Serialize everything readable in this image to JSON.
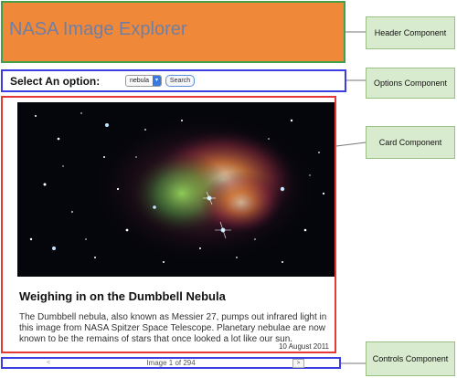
{
  "header": {
    "title": "NASA Image Explorer"
  },
  "options": {
    "label": "Select An option:",
    "selected": "nebula",
    "search_label": "Search"
  },
  "card": {
    "title": "Weighing in on the Dumbbell Nebula",
    "description": "The Dumbbell nebula, also known as Messier 27, pumps out infrared light in this image from NASA Spitzer Space Telescope. Planetary nebulae are now known to be the remains of stars that once looked a lot like our sun.",
    "date": "10 August 2011"
  },
  "controls": {
    "prev": "<",
    "count": "Image 1 of 294",
    "next": ">"
  },
  "callouts": {
    "header": "Header Component",
    "options": "Options Component",
    "card": "Card Component",
    "controls": "Controls Component"
  },
  "colors": {
    "header_bg": "#f0883a",
    "header_border": "#43a047",
    "options_border": "#3b3fe0",
    "card_border": "#e53935",
    "callout_bg": "#d9ebcf"
  }
}
